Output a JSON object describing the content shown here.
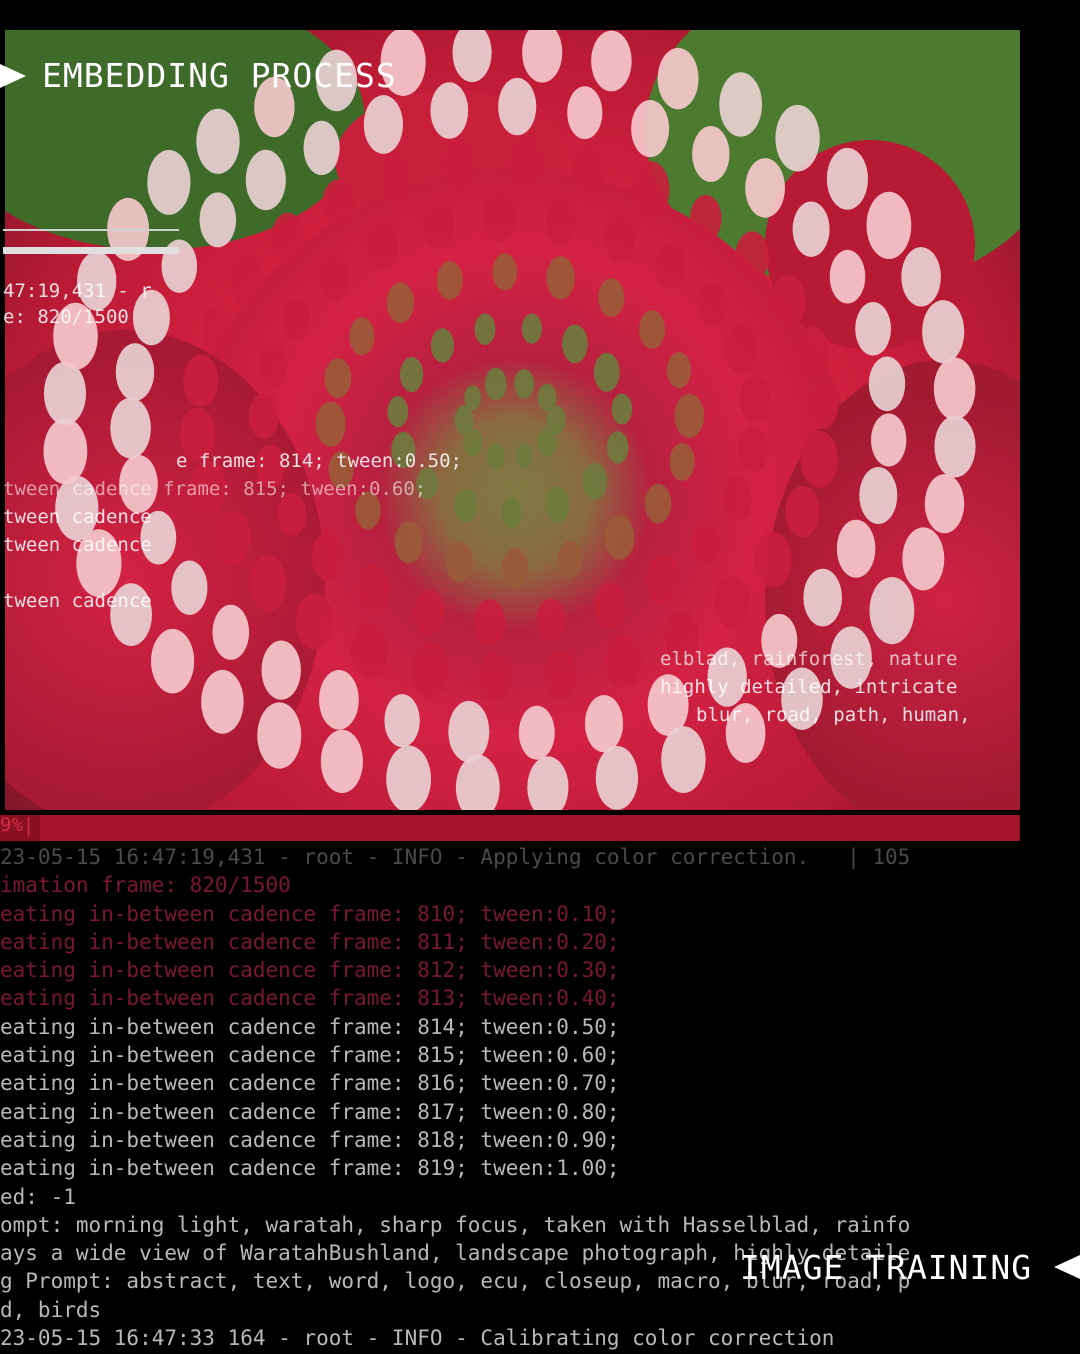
{
  "titles": {
    "top": "EMBEDDING PROCESS",
    "bottom": "IMAGE TRAINING"
  },
  "overlay_text": [
    "47:19,431 - r",
    "e: 820/1500",
    "e frame: 814; tween:0.50;",
    "tween cadence frame: 815; tween:0.60;",
    "tween cadence",
    "tween cadence",
    "tween cadence",
    "elblad, rainforest, nature",
    "highly detailed, intricate",
    "blur, road, path, human,"
  ],
  "progress": {
    "label": "9%|",
    "fraction": 0.55
  },
  "log_lines": [
    {
      "text": "23-05-15 16:47:19,431 - root - INFO - Applying color correction.   | 105",
      "style": "dim"
    },
    {
      "text": "imation frame: 820/1500",
      "style": "red"
    },
    {
      "text": "eating in-between cadence frame: 810; tween:0.10;",
      "style": "red"
    },
    {
      "text": "eating in-between cadence frame: 811; tween:0.20;",
      "style": "red"
    },
    {
      "text": "eating in-between cadence frame: 812; tween:0.30;",
      "style": "red"
    },
    {
      "text": "eating in-between cadence frame: 813; tween:0.40;",
      "style": "red"
    },
    {
      "text": "eating in-between cadence frame: 814; tween:0.50;",
      "style": "normal"
    },
    {
      "text": "eating in-between cadence frame: 815; tween:0.60;",
      "style": "normal"
    },
    {
      "text": "eating in-between cadence frame: 816; tween:0.70;",
      "style": "normal"
    },
    {
      "text": "eating in-between cadence frame: 817; tween:0.80;",
      "style": "normal"
    },
    {
      "text": "eating in-between cadence frame: 818; tween:0.90;",
      "style": "normal"
    },
    {
      "text": "eating in-between cadence frame: 819; tween:1.00;",
      "style": "normal"
    },
    {
      "text": "ed: -1",
      "style": "normal"
    },
    {
      "text": "ompt: morning light, waratah, sharp focus, taken with Hasselblad, rainfo",
      "style": "normal"
    },
    {
      "text": "ays a wide view of WaratahBushland, landscape photograph, highly detaile",
      "style": "normal"
    },
    {
      "text": "g Prompt: abstract, text, word, logo, ecu, closeup, macro, blur, road, p",
      "style": "normal"
    },
    {
      "text": "d, birds",
      "style": "normal"
    },
    {
      "text": "23-05-15 16:47:33 164 - root - INFO - Calibrating color correction",
      "style": "normal"
    }
  ],
  "colors": {
    "background": "#000000",
    "flower_red": "#d2203f",
    "progress_bar": "#a3142a"
  },
  "icons": [
    "arrow-right-icon",
    "arrow-left-icon"
  ]
}
